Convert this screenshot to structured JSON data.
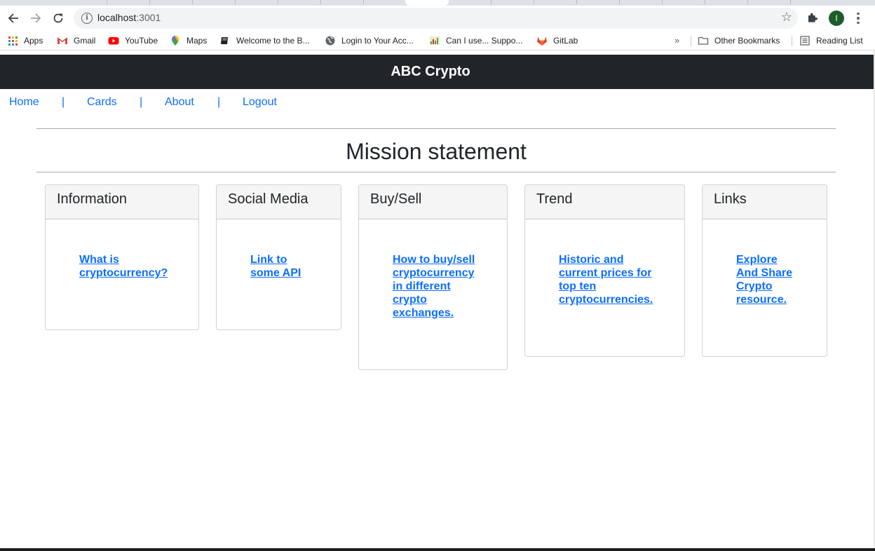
{
  "browser": {
    "url_host": "localhost",
    "url_port": ":3001",
    "profile_initial": "I",
    "bookmarks": [
      {
        "label": "Apps",
        "icon": "apps-grid-icon"
      },
      {
        "label": "Gmail",
        "icon": "gmail-icon"
      },
      {
        "label": "YouTube",
        "icon": "youtube-icon"
      },
      {
        "label": "Maps",
        "icon": "maps-pin-icon"
      },
      {
        "label": "Welcome to the B...",
        "icon": "book-icon"
      },
      {
        "label": "Login to Your Acc...",
        "icon": "globe-icon"
      },
      {
        "label": "Can I use... Suppo...",
        "icon": "caniuse-icon"
      },
      {
        "label": "GitLab",
        "icon": "gitlab-icon"
      }
    ],
    "overflow_chevron": "»",
    "other_bookmarks": "Other Bookmarks",
    "reading_list": "Reading List"
  },
  "header": {
    "title": "ABC Crypto"
  },
  "nav": {
    "items": [
      "Home",
      "Cards",
      "About",
      "Logout"
    ],
    "separator": "|"
  },
  "main": {
    "heading": "Mission statement"
  },
  "cards": [
    {
      "title": "Information",
      "link": "What is cryptocurrency?"
    },
    {
      "title": "Social Media",
      "link": "Link to some API"
    },
    {
      "title": "Buy/Sell",
      "link": "How to buy/sell cryptocurrency in different crypto exchanges."
    },
    {
      "title": "Trend",
      "link": "Historic and current prices for top ten cryptocurrencies."
    },
    {
      "title": "Links",
      "link": "Explore And Share Crypto resource."
    }
  ],
  "colors": {
    "header_bg": "#212529",
    "link": "#0d6efd",
    "card_header_bg": "#f5f5f5"
  }
}
